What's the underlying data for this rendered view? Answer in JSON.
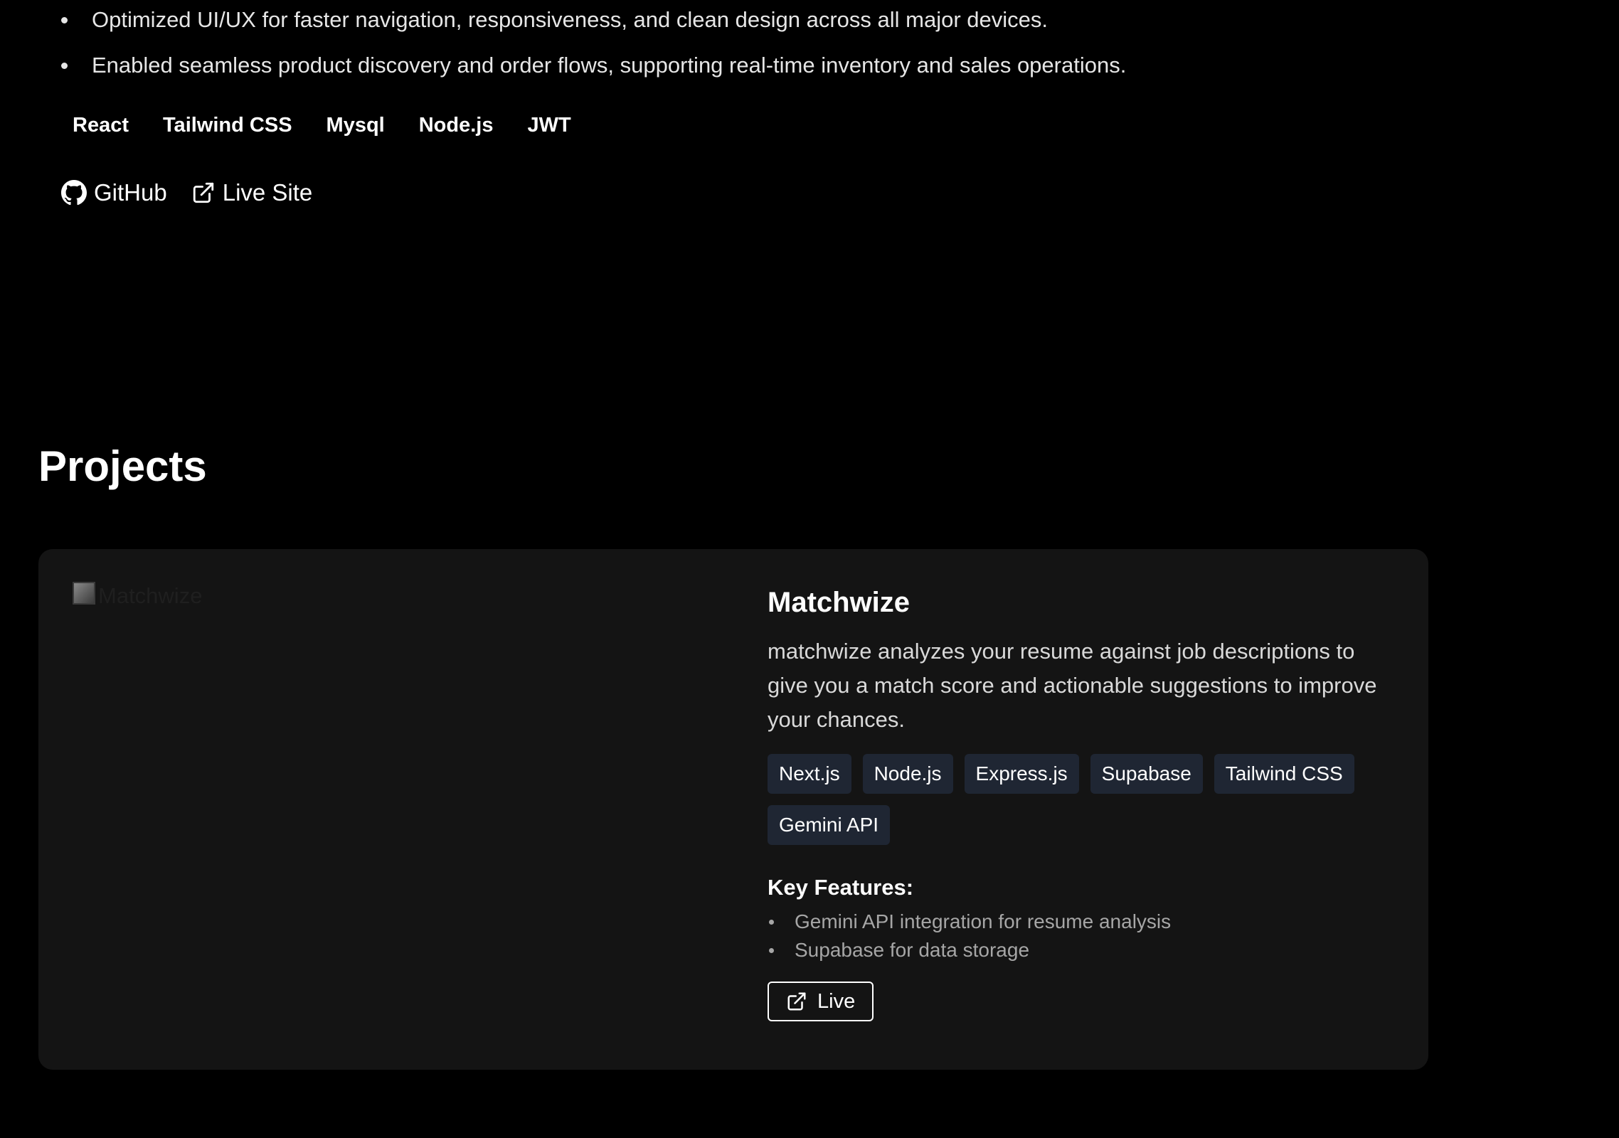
{
  "experience": {
    "bullets": [
      "Optimized UI/UX for faster navigation, responsiveness, and clean design across all major devices.",
      "Enabled seamless product discovery and order flows, supporting real-time inventory and sales operations."
    ],
    "tags": [
      "React",
      "Tailwind CSS",
      "Mysql",
      "Node.js",
      "JWT"
    ],
    "links": {
      "github": {
        "label": "GitHub",
        "icon": "github-icon"
      },
      "live_site": {
        "label": "Live Site",
        "icon": "external-link-icon"
      }
    }
  },
  "projects": {
    "heading": "Projects",
    "items": [
      {
        "image_alt": "Matchwize",
        "title": "Matchwize",
        "description": "matchwize analyzes your resume against job descriptions to give you a match score and actionable suggestions to improve your chances.",
        "tags": [
          "Next.js",
          "Node.js",
          "Express.js",
          "Supabase",
          "Tailwind CSS",
          "Gemini API"
        ],
        "features_title": "Key Features:",
        "features": [
          "Gemini API integration for resume analysis",
          "Supabase for data storage"
        ],
        "live_label": "Live",
        "live_icon": "external-link-icon"
      }
    ]
  },
  "colors": {
    "background": "#000000",
    "card": "#141414",
    "tag_bg": "#1f2633",
    "text_primary": "#ffffff",
    "text_muted": "#a6a6a6"
  }
}
